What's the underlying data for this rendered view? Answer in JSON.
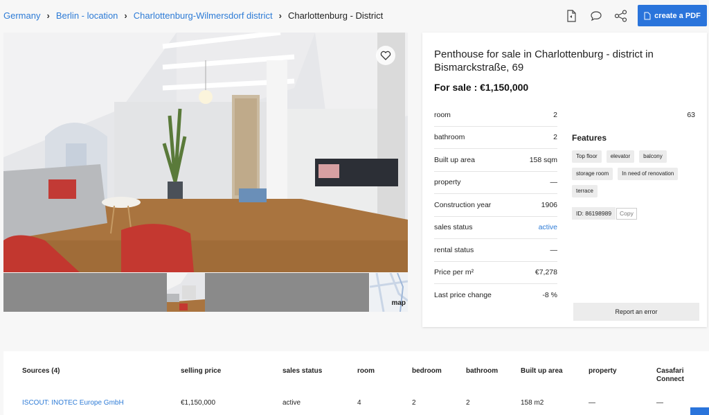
{
  "breadcrumb": {
    "items": [
      "Germany",
      "Berlin - location",
      "Charlottenburg-Wilmersdorf district"
    ],
    "current": "Charlottenburg - District"
  },
  "toolbar": {
    "icons": [
      "document-icon",
      "comment-icon",
      "share-icon"
    ],
    "pdf_label": "create a PDF"
  },
  "gallery": {
    "map_label": "map"
  },
  "listing": {
    "title": "Penthouse for sale in Charlottenburg - district in Bismarckstraße, 69",
    "price": "For sale : €1,150,000",
    "side_count": "63",
    "attributes": [
      {
        "label": "room",
        "value": "2"
      },
      {
        "label": "bathroom",
        "value": "2"
      },
      {
        "label": "Built up area",
        "value": "158 sqm"
      },
      {
        "label": "property",
        "value": "—"
      },
      {
        "label": "Construction year",
        "value": "1906"
      },
      {
        "label": "sales status",
        "value": "active"
      },
      {
        "label": "rental status",
        "value": "—"
      },
      {
        "label": "Price per m²",
        "value": "€7,278"
      },
      {
        "label": "Last price change",
        "value": "-8 %"
      }
    ],
    "features_title": "Features",
    "features": [
      "Top floor",
      "elevator",
      "balcony",
      "storage room",
      "In need of renovation",
      "terrace"
    ],
    "id_text": "ID: 86198989",
    "copy_label": "Copy",
    "report_label": "Report an error"
  },
  "sources": {
    "headers": [
      "Sources (4)",
      "selling price",
      "sales status",
      "room",
      "bedroom",
      "bathroom",
      "Built up area",
      "property",
      "Casafari Connect"
    ],
    "row": [
      "ISCOUT: INOTEC Europe GmbH",
      "€1,150,000",
      "active",
      "4",
      "2",
      "2",
      "158 m2",
      "—",
      "—"
    ]
  },
  "colors": {
    "accent": "#2a74db",
    "link": "#2d7bd6"
  }
}
